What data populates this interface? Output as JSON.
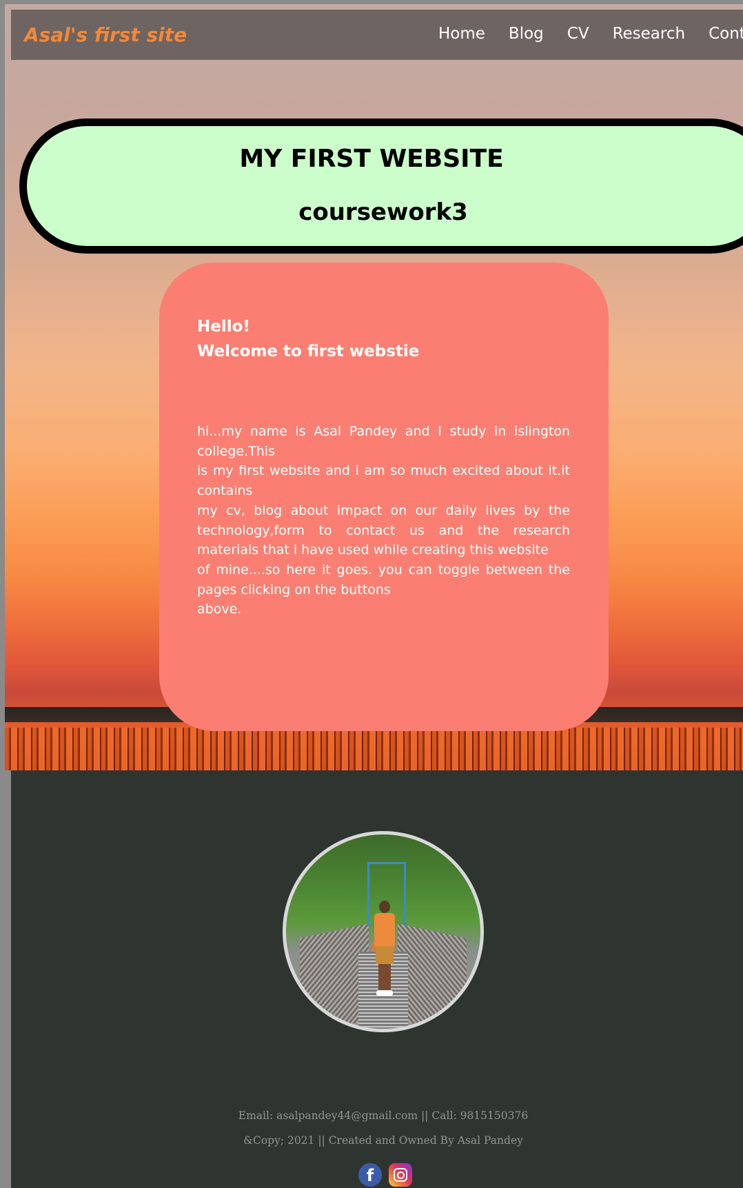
{
  "navbar": {
    "brand": "Asal's first site",
    "links": [
      "Home",
      "Blog",
      "CV",
      "Research",
      "Contact"
    ]
  },
  "banner": {
    "title": "MY FIRST WEBSITE",
    "subtitle": "coursework3"
  },
  "intro": {
    "greeting": "Hello!",
    "welcome": "Welcome to first webstie",
    "paragraph": [
      "hi...my name is Asal Pandey and I study in islington college.This",
      "is my first website and i am so much excited about it.it contains",
      "my cv, blog about impact on our daily lives by the technology,form to contact us and the research materials that i have used while creating this website",
      "of mine....so here it goes. you can toggle between the pages clicking on the buttons",
      "above."
    ]
  },
  "footer": {
    "contact": "Email: asalpandey44@gmail.com || Call: 9815150376",
    "copyright": "&Copy; 2021 || Created and Owned By Asal Pandey",
    "social_icons": [
      "facebook-icon",
      "instagram-icon"
    ],
    "facebook_glyph": "f"
  },
  "colors": {
    "brand": "#f2893a",
    "banner_bg": "#ccfecc",
    "card_bg": "#fa7f72",
    "footer_bg": "#2e3530",
    "navbar_bg": "#6e6461"
  }
}
